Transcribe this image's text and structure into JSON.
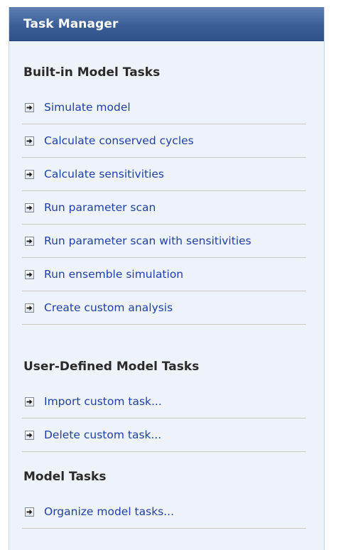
{
  "panel": {
    "title": "Task Manager"
  },
  "sections": [
    {
      "title": "Built-in Model Tasks",
      "items": [
        {
          "label": "Simulate model",
          "icon": "arrow-right-icon"
        },
        {
          "label": "Calculate conserved cycles",
          "icon": "arrow-right-icon"
        },
        {
          "label": "Calculate sensitivities",
          "icon": "arrow-right-icon"
        },
        {
          "label": "Run parameter scan",
          "icon": "arrow-right-icon"
        },
        {
          "label": "Run parameter scan with sensitivities",
          "icon": "arrow-right-icon"
        },
        {
          "label": "Run ensemble simulation",
          "icon": "arrow-right-icon"
        },
        {
          "label": "Create custom analysis",
          "icon": "arrow-right-icon"
        }
      ]
    },
    {
      "title": "User-Defined Model Tasks",
      "items": [
        {
          "label": "Import custom task...",
          "icon": "arrow-right-icon"
        },
        {
          "label": "Delete custom task...",
          "icon": "arrow-right-icon"
        }
      ]
    },
    {
      "title": "Model Tasks",
      "items": [
        {
          "label": "Organize model tasks...",
          "icon": "arrow-right-icon"
        }
      ]
    }
  ],
  "colors": {
    "header_bg": "#3c5f98",
    "panel_bg": "#eef3f9",
    "link_text": "#1f3fa7",
    "section_text": "#2a2a2a"
  }
}
